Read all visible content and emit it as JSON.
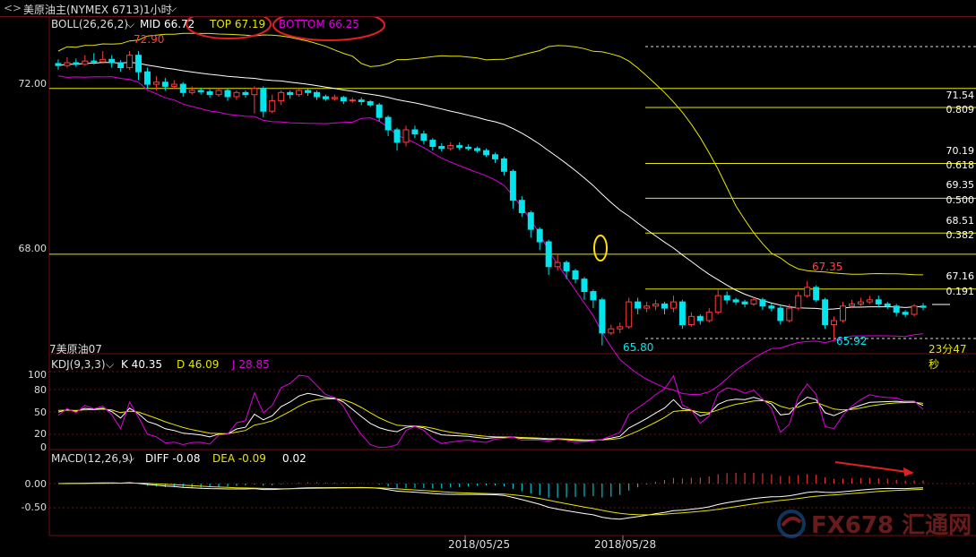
{
  "header": {
    "icons": "<>",
    "symbol": "美原油主(NYMEX 6713)",
    "period": "1小时",
    "chevron_icon": "chevron-down-icon"
  },
  "legend": {
    "boll_name": "BOLL(26,26,2)",
    "mid": "MID 66.72",
    "top": "TOP 67.19",
    "bottom": "BOTTOM 66.25",
    "kdj_name": "KDJ(9,3,3)",
    "k": "K 40.35",
    "d": "D 46.09",
    "j": "J 28.85",
    "macd_name": "MACD(12,26,9)",
    "diff": "DIFF -0.08",
    "dea": "DEA -0.09",
    "macd_val": "0.02"
  },
  "price_axis": [
    "72.00",
    "68.00"
  ],
  "kdj_axis": [
    "100",
    "80",
    "50",
    "20",
    "0"
  ],
  "macd_axis": [
    "0.00",
    "-0.50"
  ],
  "dates": [
    "2018/05/25",
    "2018/05/28"
  ],
  "fib_levels": [
    {
      "price": "71.54",
      "ratio": "0.809"
    },
    {
      "price": "70.19",
      "ratio": "0.618"
    },
    {
      "price": "69.35",
      "ratio": "0.500"
    },
    {
      "price": "68.51",
      "ratio": "0.382"
    },
    {
      "price": "67.16",
      "ratio": "0.191"
    }
  ],
  "annotations": {
    "high": "72.90",
    "low1": "65.80",
    "high2": "67.35",
    "low2": "65.92",
    "contract": "7美原油07",
    "countdown": "23分47秒"
  },
  "watermark": "FX678 汇通网",
  "colors": {
    "up": "#ff3c3c",
    "down": "#00e5ee",
    "mid_line": "#ffffff",
    "top_line": "#e6e600",
    "bottom_line": "#e000e0",
    "grid": "#6b1010",
    "fib_line": "#e6e600",
    "highlight_circle": "#e02020"
  },
  "chart_data": {
    "type": "candlestick",
    "title": "美原油主(NYMEX 6713) 1小时",
    "ylim": [
      65.6,
      73.7
    ],
    "candles": [
      [
        72.6,
        72.55,
        72.7,
        72.45
      ],
      [
        72.55,
        72.62,
        72.75,
        72.5
      ],
      [
        72.62,
        72.58,
        72.72,
        72.52
      ],
      [
        72.58,
        72.66,
        72.8,
        72.55
      ],
      [
        72.66,
        72.64,
        72.85,
        72.58
      ],
      [
        72.64,
        72.7,
        72.9,
        72.6
      ],
      [
        72.7,
        72.62,
        72.8,
        72.5
      ],
      [
        72.62,
        72.5,
        72.68,
        72.4
      ],
      [
        72.5,
        72.8,
        72.9,
        72.45
      ],
      [
        72.8,
        72.4,
        72.9,
        72.2
      ],
      [
        72.4,
        72.1,
        72.5,
        72.0
      ],
      [
        72.1,
        72.15,
        72.3,
        71.95
      ],
      [
        72.15,
        72.05,
        72.25,
        71.95
      ],
      [
        72.05,
        72.1,
        72.2,
        71.98
      ],
      [
        72.1,
        71.9,
        72.15,
        71.8
      ],
      [
        71.9,
        71.95,
        72.05,
        71.85
      ],
      [
        71.95,
        71.92,
        72.02,
        71.85
      ],
      [
        71.92,
        71.85,
        71.98,
        71.78
      ],
      [
        71.85,
        71.95,
        72.0,
        71.8
      ],
      [
        71.95,
        71.8,
        72.0,
        71.7
      ],
      [
        71.8,
        71.9,
        71.95,
        71.72
      ],
      [
        71.9,
        71.85,
        71.95,
        71.78
      ],
      [
        71.85,
        72.0,
        72.05,
        71.4
      ],
      [
        72.0,
        71.45,
        72.05,
        71.3
      ],
      [
        71.45,
        71.7,
        71.85,
        71.4
      ],
      [
        71.7,
        71.9,
        71.95,
        71.6
      ],
      [
        71.9,
        71.85,
        71.95,
        71.75
      ],
      [
        71.85,
        71.95,
        72.0,
        71.8
      ],
      [
        71.95,
        71.9,
        72.0,
        71.82
      ],
      [
        71.9,
        71.8,
        71.95,
        71.72
      ],
      [
        71.8,
        71.75,
        71.85,
        71.7
      ],
      [
        71.75,
        71.78,
        71.85,
        71.7
      ],
      [
        71.78,
        71.7,
        71.82,
        71.62
      ],
      [
        71.7,
        71.72,
        71.78,
        71.65
      ],
      [
        71.72,
        71.68,
        71.78,
        71.6
      ],
      [
        71.68,
        71.6,
        71.72,
        71.55
      ],
      [
        71.6,
        71.3,
        71.65,
        71.2
      ],
      [
        71.3,
        71.0,
        71.35,
        70.85
      ],
      [
        71.0,
        70.7,
        71.05,
        70.5
      ],
      [
        70.7,
        71.0,
        71.1,
        70.6
      ],
      [
        71.0,
        70.9,
        71.1,
        70.8
      ],
      [
        70.9,
        70.75,
        70.98,
        70.65
      ],
      [
        70.75,
        70.6,
        70.8,
        70.5
      ],
      [
        70.6,
        70.55,
        70.68,
        70.48
      ],
      [
        70.55,
        70.62,
        70.7,
        70.5
      ],
      [
        70.62,
        70.58,
        70.7,
        70.52
      ],
      [
        70.58,
        70.55,
        70.65,
        70.5
      ],
      [
        70.55,
        70.5,
        70.6,
        70.45
      ],
      [
        70.5,
        70.4,
        70.55,
        70.35
      ],
      [
        70.4,
        70.3,
        70.45,
        70.2
      ],
      [
        70.3,
        70.0,
        70.35,
        69.9
      ],
      [
        70.0,
        69.3,
        70.05,
        69.1
      ],
      [
        69.3,
        69.0,
        69.4,
        68.9
      ],
      [
        69.0,
        68.6,
        69.05,
        68.4
      ],
      [
        68.6,
        68.3,
        68.65,
        68.1
      ],
      [
        68.3,
        67.7,
        68.35,
        67.5
      ],
      [
        67.7,
        67.8,
        68.0,
        67.6
      ],
      [
        67.8,
        67.6,
        67.85,
        67.4
      ],
      [
        67.6,
        67.4,
        67.65,
        67.3
      ],
      [
        67.4,
        67.1,
        67.45,
        66.9
      ],
      [
        67.1,
        66.9,
        67.15,
        66.7
      ],
      [
        66.9,
        66.1,
        66.95,
        65.8
      ],
      [
        66.1,
        66.2,
        66.3,
        66.05
      ],
      [
        66.2,
        66.25,
        66.35,
        66.1
      ],
      [
        66.25,
        66.85,
        66.95,
        66.2
      ],
      [
        66.85,
        66.7,
        66.95,
        66.55
      ],
      [
        66.7,
        66.75,
        66.85,
        66.6
      ],
      [
        66.75,
        66.8,
        66.9,
        66.65
      ],
      [
        66.8,
        66.7,
        66.85,
        66.55
      ],
      [
        66.7,
        66.85,
        67.0,
        66.6
      ],
      [
        66.85,
        66.3,
        66.9,
        66.2
      ],
      [
        66.3,
        66.5,
        66.6,
        66.25
      ],
      [
        66.5,
        66.4,
        66.55,
        66.3
      ],
      [
        66.4,
        66.6,
        66.7,
        66.35
      ],
      [
        66.6,
        67.0,
        67.15,
        66.55
      ],
      [
        67.0,
        66.9,
        67.1,
        66.8
      ],
      [
        66.9,
        66.85,
        66.95,
        66.78
      ],
      [
        66.85,
        66.8,
        66.9,
        66.72
      ],
      [
        66.8,
        66.9,
        66.98,
        66.75
      ],
      [
        66.9,
        66.75,
        66.95,
        66.65
      ],
      [
        66.75,
        66.7,
        66.82,
        66.62
      ],
      [
        66.7,
        66.4,
        66.75,
        66.3
      ],
      [
        66.4,
        66.7,
        66.8,
        66.35
      ],
      [
        66.7,
        67.0,
        67.1,
        66.65
      ],
      [
        67.0,
        67.2,
        67.35,
        66.95
      ],
      [
        67.2,
        66.9,
        67.25,
        66.85
      ],
      [
        66.9,
        66.3,
        66.95,
        66.2
      ],
      [
        66.3,
        66.4,
        66.5,
        65.92
      ],
      [
        66.4,
        66.75,
        66.85,
        66.35
      ],
      [
        66.75,
        66.8,
        66.9,
        66.7
      ],
      [
        66.8,
        66.85,
        66.95,
        66.75
      ],
      [
        66.85,
        66.9,
        67.0,
        66.8
      ],
      [
        66.9,
        66.8,
        67.0,
        66.72
      ],
      [
        66.8,
        66.75,
        66.85,
        66.68
      ],
      [
        66.75,
        66.6,
        66.8,
        66.5
      ],
      [
        66.6,
        66.55,
        66.65,
        66.48
      ],
      [
        66.55,
        66.75,
        66.8,
        66.5
      ],
      [
        66.75,
        66.72,
        66.82,
        66.65
      ]
    ],
    "fib": [
      71.54,
      70.19,
      69.35,
      68.51,
      67.16
    ],
    "horizontal": [
      72.0,
      68.0
    ]
  }
}
